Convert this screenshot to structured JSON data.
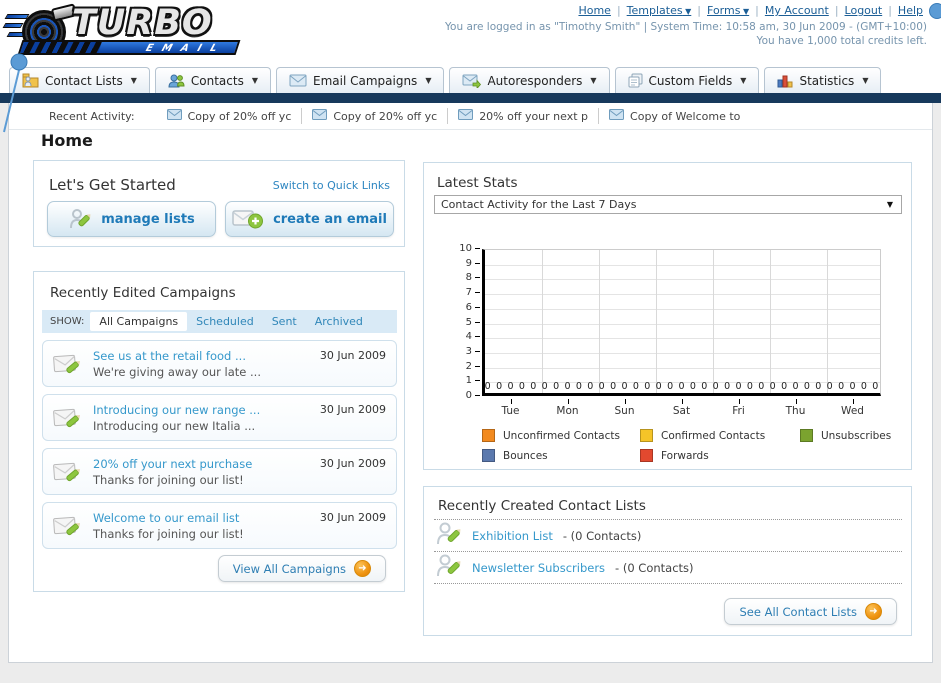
{
  "logo": {
    "title": "TURBO",
    "subtitle": "EMAIL"
  },
  "top_nav": {
    "links": [
      {
        "label": "Home",
        "dropdown": false
      },
      {
        "label": "Templates",
        "dropdown": true
      },
      {
        "label": "Forms",
        "dropdown": true
      },
      {
        "label": "My Account",
        "dropdown": false
      },
      {
        "label": "Logout",
        "dropdown": false
      },
      {
        "label": "Help",
        "dropdown": false
      }
    ],
    "login_info": "You are logged in as \"Timothy Smith\" | System Time: 10:58 am, 30 Jun 2009 - (GMT+10:00)",
    "credits": "You have 1,000 total credits left."
  },
  "main_nav": {
    "tabs": [
      {
        "label": "Contact Lists",
        "icon": "folder-icon"
      },
      {
        "label": "Contacts",
        "icon": "contacts-icon"
      },
      {
        "label": "Email Campaigns",
        "icon": "envelope-icon"
      },
      {
        "label": "Autoresponders",
        "icon": "autoresponder-icon"
      },
      {
        "label": "Custom Fields",
        "icon": "fields-icon"
      },
      {
        "label": "Statistics",
        "icon": "statistics-icon"
      }
    ]
  },
  "recent_activity": {
    "label": "Recent Activity:",
    "items": [
      "Copy of 20% off yc",
      "Copy of 20% off yc",
      "20% off your next p",
      "Copy of Welcome to"
    ]
  },
  "page": {
    "title": "Home"
  },
  "get_started": {
    "title": "Let's Get Started",
    "switch_link": "Switch to Quick Links",
    "buttons": [
      {
        "label": "manage lists",
        "icon": "person-pencil-icon"
      },
      {
        "label": "create an email",
        "icon": "envelope-plus-icon"
      }
    ]
  },
  "campaigns": {
    "title": "Recently Edited Campaigns",
    "filter_label": "SHOW:",
    "filters": [
      {
        "label": "All Campaigns",
        "active": true
      },
      {
        "label": "Scheduled",
        "active": false
      },
      {
        "label": "Sent",
        "active": false
      },
      {
        "label": "Archived",
        "active": false
      }
    ],
    "items": [
      {
        "title": "See us at the retail food ...",
        "subtitle": "We're giving away our late ...",
        "date": "30 Jun 2009"
      },
      {
        "title": "Introducing our new range ...",
        "subtitle": "Introducing our new Italia ...",
        "date": "30 Jun 2009"
      },
      {
        "title": "20% off your next purchase",
        "subtitle": "Thanks for joining our list!",
        "date": "30 Jun 2009"
      },
      {
        "title": "Welcome to our email list",
        "subtitle": "Thanks for joining our list!",
        "date": "30 Jun 2009"
      }
    ],
    "view_all_label": "View All Campaigns"
  },
  "stats": {
    "title": "Latest Stats",
    "dropdown_value": "Contact Activity for the Last 7 Days"
  },
  "chart_data": {
    "type": "bar",
    "categories": [
      "Tue",
      "Mon",
      "Sun",
      "Sat",
      "Fri",
      "Thu",
      "Wed"
    ],
    "series": [
      {
        "name": "Unconfirmed Contacts",
        "color": "#f28a1f",
        "values": [
          0,
          0,
          0,
          0,
          0,
          0,
          0
        ]
      },
      {
        "name": "Confirmed Contacts",
        "color": "#f5c428",
        "values": [
          0,
          0,
          0,
          0,
          0,
          0,
          0
        ]
      },
      {
        "name": "Unsubscribes",
        "color": "#7ba32f",
        "values": [
          0,
          0,
          0,
          0,
          0,
          0,
          0
        ]
      },
      {
        "name": "Bounces",
        "color": "#5b79ae",
        "values": [
          0,
          0,
          0,
          0,
          0,
          0,
          0
        ]
      },
      {
        "name": "Forwards",
        "color": "#e2492f",
        "values": [
          0,
          0,
          0,
          0,
          0,
          0,
          0
        ]
      }
    ],
    "title": "Contact Activity for the Last 7 Days",
    "xlabel": "",
    "ylabel": "",
    "ylim": [
      0,
      10
    ],
    "yticks": [
      0,
      1,
      2,
      3,
      4,
      5,
      6,
      7,
      8,
      9,
      10
    ],
    "grid": true,
    "legend_position": "bottom",
    "data_labels": "each bar labeled 0"
  },
  "contact_lists": {
    "title": "Recently Created Contact Lists",
    "items": [
      {
        "name": "Exhibition List",
        "detail": "- (0 Contacts)"
      },
      {
        "name": "Newsletter Subscribers",
        "detail": "- (0 Contacts)"
      }
    ],
    "see_all_label": "See All Contact Lists"
  },
  "colors": {
    "navy_bar": "#17395c",
    "link_blue": "#2e86c1",
    "campaign_link": "#3598cb",
    "filter_bar_bg": "#d9eaf6",
    "orange_arrow": "#ef9412",
    "annotation_blue": "#5b9bd5"
  }
}
